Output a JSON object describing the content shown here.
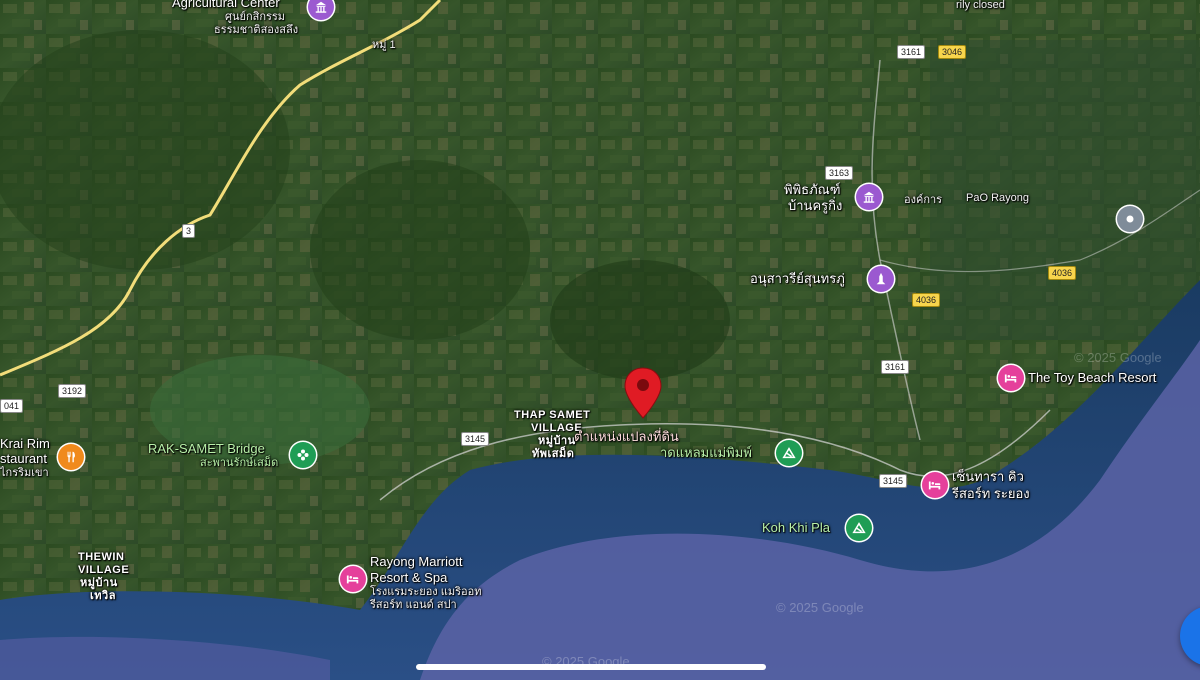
{
  "map": {
    "labels": {
      "agri_center_en": "Agricultural Center",
      "agri_center_th1": "ศูนย์กสิกรรม",
      "agri_center_th2": "ธรรมชาติสองสลึง",
      "moo1": "หมู่ 1",
      "temp_closed": "rily closed",
      "museum_th1": "พิพิธภัณฑ์",
      "museum_th2": "บ้านครูกิ่ง",
      "pao": "องค์การ",
      "pao_rayong": "PaO Rayong",
      "sunthorn": "อนุสาวรีย์สุนทรภู่",
      "toy_beach": "The Toy Beach Resort",
      "thap_samet_en1": "THAP SAMET",
      "thap_samet_en2": "VILLAGE",
      "thap_samet_th1": "หมู่บ้าน",
      "thap_samet_th2": "ทัพเสม็ด",
      "pinned_th": "ตำแหน่งแปลงที่ดิน",
      "beach_th": "าดแหลมแม่พิมพ์",
      "cintara_th1": "เซ็นทารา คิว",
      "cintara_th2": "รีสอร์ท ระยอง",
      "koh_khi_pla": "Koh Khi Pla",
      "krai_rim1": "Krai Rim",
      "krai_rim2": "staurant",
      "krai_rim_th": "ไกรริมเขา",
      "rak_samet": "RAK-SAMET Bridge",
      "rak_samet_th": "สะพานรักษ์เสม็ด",
      "thewin1": "THEWIN",
      "thewin2": "VILLAGE",
      "thewin_th1": "หมู่บ้าน",
      "thewin_th2": "เทวิล",
      "marriott1": "Rayong Marriott",
      "marriott2": "Resort & Spa",
      "marriott_th1": "โรงแรมระยอง แมริออท",
      "marriott_th2": "รีสอร์ท แอนด์ สปา"
    },
    "shields": {
      "r3": "3",
      "r3161a": "3161",
      "r3046": "3046",
      "r3163": "3163",
      "r4036a": "4036",
      "r4036b": "4036",
      "r3161b": "3161",
      "r3192": "3192",
      "r041": "041",
      "r3145a": "3145",
      "r3145b": "3145"
    },
    "watermarks": [
      "© 2025 Google",
      "© 2025 Google",
      "© 2025 Google"
    ],
    "colors": {
      "sea": "#1e3f6e",
      "deep_sea": "#5a63a6",
      "land": "#2f4f24",
      "road": "#f2dd7a",
      "pin_red": "#e01b24",
      "hotel_pink": "#e5409b",
      "attraction_purple": "#9b59d0",
      "park_green": "#1f9d55",
      "restaurant_orange": "#f08a1c"
    }
  }
}
